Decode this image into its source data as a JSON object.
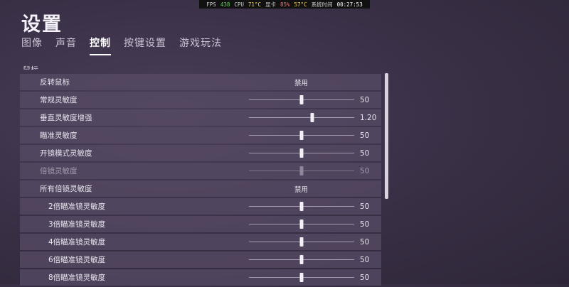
{
  "perf": {
    "fps_label": "FPS",
    "fps_value": "438",
    "cpu_label": "CPU",
    "cpu_temp": "71°C",
    "gpu_label": "显卡",
    "gpu_usage": "85%",
    "gpu_temp": "57°C",
    "time_label": "系统时间",
    "time_value": "00:27:53"
  },
  "title": "设置",
  "tabs": [
    {
      "label": "图像",
      "active": false
    },
    {
      "label": "声音",
      "active": false
    },
    {
      "label": "控制",
      "active": true
    },
    {
      "label": "按键设置",
      "active": false
    },
    {
      "label": "游戏玩法",
      "active": false
    }
  ],
  "section": "鼠标",
  "rows": [
    {
      "label": "反转鼠标",
      "type": "toggle",
      "value": "禁用"
    },
    {
      "label": "常规灵敏度",
      "type": "slider",
      "value": "50",
      "level": 0.5
    },
    {
      "label": "垂直灵敏度增强",
      "type": "slider",
      "value": "1.20",
      "level": 0.6
    },
    {
      "label": "瞄准灵敏度",
      "type": "slider",
      "value": "50",
      "level": 0.5
    },
    {
      "label": "开镜模式灵敏度",
      "type": "slider",
      "value": "50",
      "level": 0.5
    },
    {
      "label": "倍镜灵敏度",
      "type": "slider",
      "value": "50",
      "level": 0.5,
      "dim": true
    },
    {
      "label": "所有倍镜灵敏度",
      "type": "toggle",
      "value": "禁用"
    },
    {
      "label": "2倍瞄准镜灵敏度",
      "type": "slider",
      "value": "50",
      "level": 0.5,
      "indent": true
    },
    {
      "label": "3倍瞄准镜灵敏度",
      "type": "slider",
      "value": "50",
      "level": 0.5,
      "indent": true
    },
    {
      "label": "4倍瞄准镜灵敏度",
      "type": "slider",
      "value": "50",
      "level": 0.5,
      "indent": true
    },
    {
      "label": "6倍瞄准镜灵敏度",
      "type": "slider",
      "value": "50",
      "level": 0.5,
      "indent": true
    },
    {
      "label": "8倍瞄准镜灵敏度",
      "type": "slider",
      "value": "50",
      "level": 0.5,
      "indent": true
    }
  ]
}
